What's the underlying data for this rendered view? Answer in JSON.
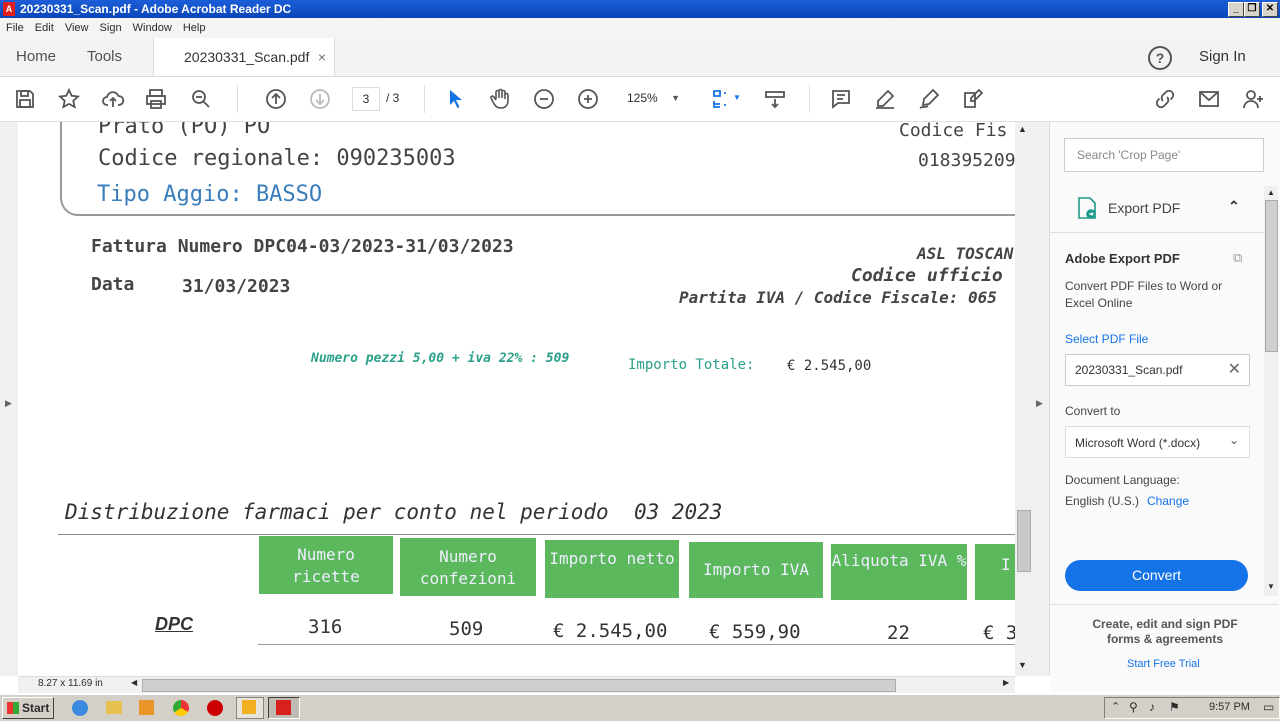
{
  "window": {
    "title": "20230331_Scan.pdf - Adobe Acrobat Reader DC",
    "controls": [
      "_",
      "❐",
      "✕"
    ]
  },
  "menu": [
    "File",
    "Edit",
    "View",
    "Sign",
    "Window",
    "Help"
  ],
  "tabs": {
    "home": "Home",
    "tools": "Tools",
    "doc": "20230331_Scan.pdf",
    "close": "×",
    "help": "?",
    "signin": "Sign In"
  },
  "toolbar": {
    "page_current": "3",
    "page_total": "/ 3",
    "zoom": "125%"
  },
  "document": {
    "addr_line": "Prato (PO) PO",
    "codice_regionale": "Codice regionale: 090235003",
    "tipo_aggio": "Tipo Aggio: BASSO",
    "codice_fiscale_label": "Codice Fis",
    "codice_fiscale_value": "018395209",
    "fattura": "Fattura Numero DPC04-03/2023-31/03/2023",
    "data_label": "Data",
    "data_value": "31/03/2023",
    "asl": "ASL TOSCAN",
    "codice_ufficio": "Codice ufficio",
    "partita_iva": "Partita IVA / Codice Fiscale: 065",
    "pezzi": "Numero pezzi 5,00 + iva 22% : 509",
    "importo_label": "Importo Totale:",
    "importo_value": "€ 2.545,00",
    "distribuzione": "Distribuzione farmaci per conto nel periodo  03 2023",
    "table_headers": [
      "Numero ricette",
      "Numero confezioni",
      "Importo netto",
      "Importo IVA",
      "Aliquota IVA %",
      "I"
    ],
    "row_label": "DPC",
    "row_values": [
      "316",
      "509",
      "€ 2.545,00",
      "€ 559,90",
      "22",
      "€ 3"
    ]
  },
  "status": {
    "page_size": "8.27 x 11.69 in"
  },
  "panel": {
    "search_placeholder": "Search 'Crop Page'",
    "export_title": "Export PDF",
    "adobe_export": "Adobe Export PDF",
    "convert_desc": "Convert PDF Files to Word or Excel Online",
    "select_file": "Select PDF File",
    "file_name": "20230331_Scan.pdf",
    "convert_to": "Convert to",
    "format": "Microsoft Word (*.docx)",
    "doc_lang_label": "Document Language:",
    "doc_lang_value": "English (U.S.)",
    "change": "Change",
    "convert_button": "Convert",
    "promo": "Create, edit and sign PDF forms & agreements",
    "trial": "Start Free Trial"
  },
  "taskbar": {
    "start": "Start",
    "clock": "9:57 PM"
  },
  "colors": {
    "accent": "#1473e6",
    "header_green": "#5cb85c",
    "teal_text": "#2aa08a",
    "blue_text": "#3a7dbd"
  }
}
